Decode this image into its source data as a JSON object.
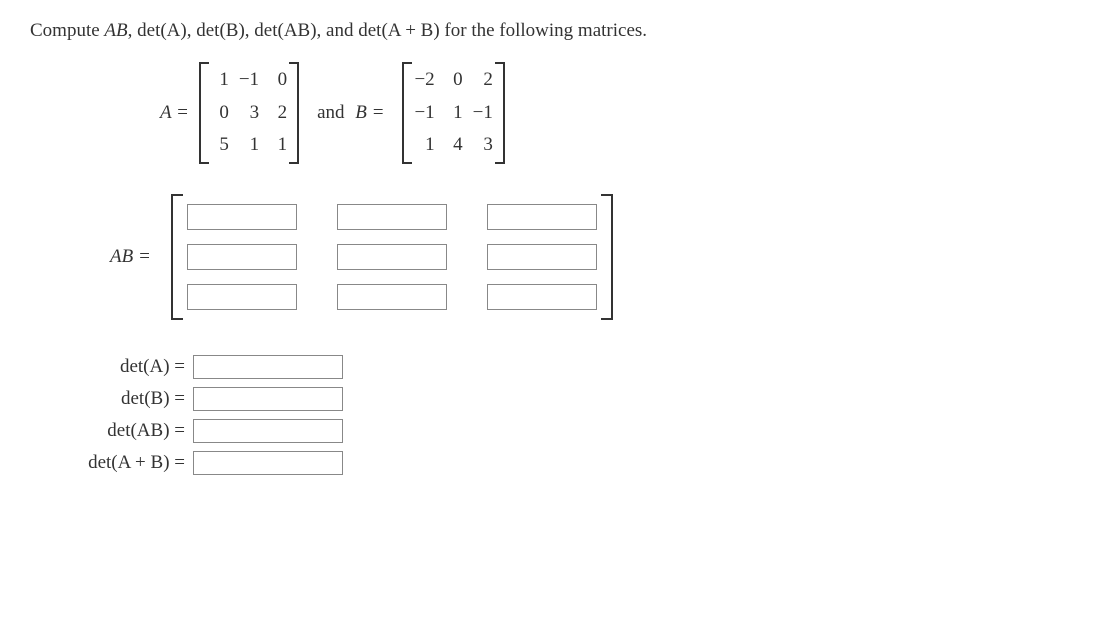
{
  "prompt": {
    "prefix": "Compute ",
    "terms": [
      "AB",
      "det(A)",
      "det(B)",
      "det(AB)",
      "det(A + B)"
    ],
    "separator": ", ",
    "last_separator": ", and ",
    "suffix": " for the following matrices."
  },
  "matrixA": {
    "label": "A =",
    "rows": [
      [
        "1",
        "−1",
        "0"
      ],
      [
        "0",
        "3",
        "2"
      ],
      [
        "5",
        "1",
        "1"
      ]
    ]
  },
  "connector": "and",
  "matrixB": {
    "label": "B =",
    "rows": [
      [
        "−2",
        "0",
        "2"
      ],
      [
        "−1",
        "1",
        "−1"
      ],
      [
        "1",
        "4",
        "3"
      ]
    ]
  },
  "ab": {
    "label": "AB  =",
    "inputs": [
      [
        "",
        "",
        ""
      ],
      [
        "",
        "",
        ""
      ],
      [
        "",
        "",
        ""
      ]
    ]
  },
  "determinants": [
    {
      "label": "det(A)  =",
      "value": ""
    },
    {
      "label": "det(B)  =",
      "value": ""
    },
    {
      "label": "det(AB)  =",
      "value": ""
    },
    {
      "label": "det(A + B)  =",
      "value": ""
    }
  ]
}
